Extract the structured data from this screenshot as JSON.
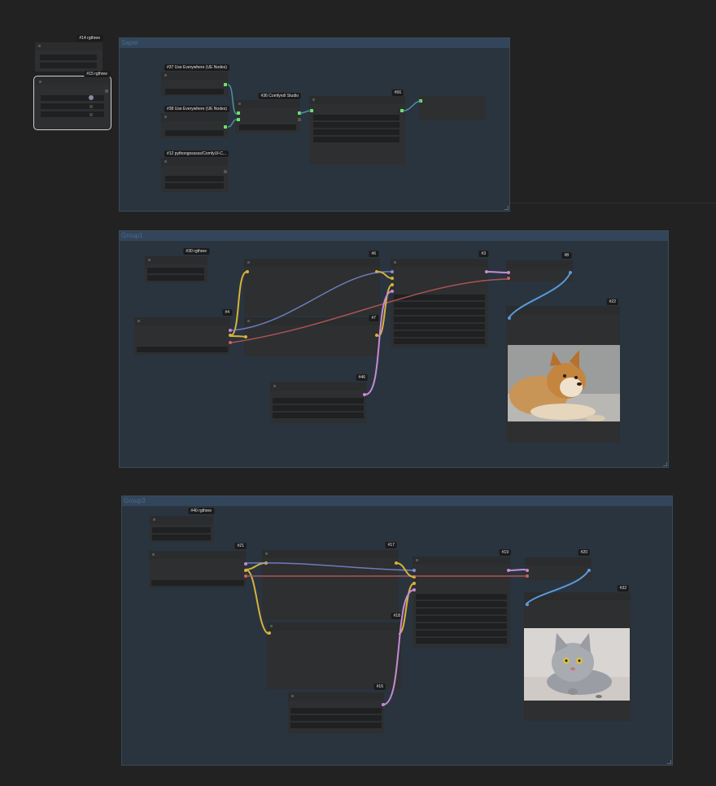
{
  "groups": {
    "g1_title": "Saper",
    "g2_title": "Group1",
    "g3_title": "Group3"
  },
  "badges": {
    "n14": "#14 rgthree",
    "n15": "#15 rgthree",
    "n37": "#37 Use Everywhere (UE Nodes)",
    "n38": "#38 Use Everywhere (UE Nodes)",
    "n36": "#36 Comfyroll Studio",
    "n56": "#56",
    "n12": "#12 pythongosssss/ComfyUI-C...",
    "n30": "#30 rgthree",
    "n6": "#6",
    "n3": "#3",
    "n8": "#8",
    "n4": "#4",
    "n7": "#7",
    "n22": "#22",
    "n46": "#46",
    "n40": "#40 rgthree",
    "n21": "#21",
    "n17": "#17",
    "n19": "#19",
    "n20": "#20",
    "n18": "#18",
    "n32": "#32",
    "n16": "#16"
  },
  "images": {
    "dog_label": "shiba dog image",
    "cat_label": "grey kitten image"
  },
  "colors": {
    "background": "#222222",
    "group_fill": "#2a343e",
    "group_bar": "#32455a",
    "node": "#2d2f31",
    "wire_yellow": "#d8b23a",
    "wire_purple": "#c68ad6",
    "wire_blue": "#7f8fe0",
    "wire_red": "#c45a5a",
    "wire_cyan": "#5a9ad8",
    "wire_green": "#6be06b"
  }
}
